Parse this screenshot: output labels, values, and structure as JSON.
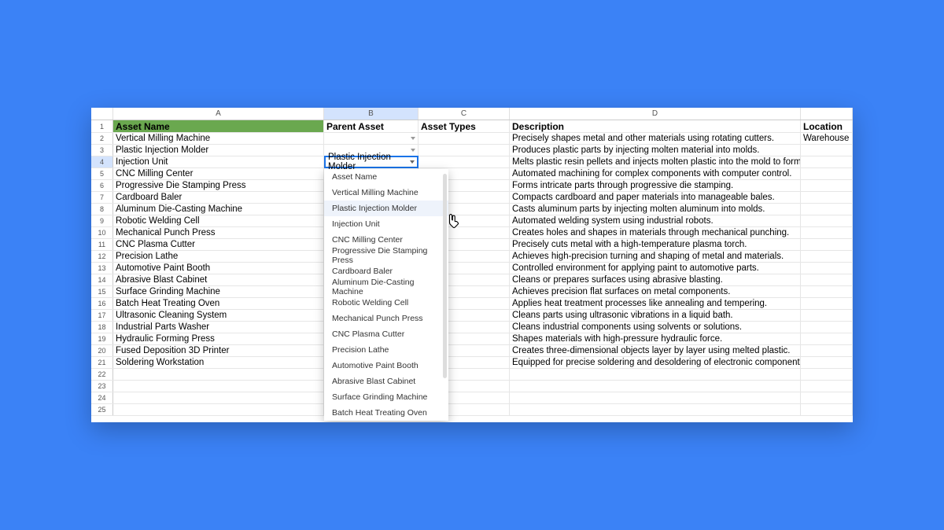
{
  "columns": [
    "A",
    "B",
    "C",
    "D"
  ],
  "selected_column_index": 1,
  "headers": {
    "A": "Asset Name",
    "B": "Parent Asset",
    "C": "Asset Types",
    "D": "Description",
    "E": "Location"
  },
  "active_cell": "Plastic Injection Molder",
  "rows": [
    {
      "n": 2,
      "A": "Vertical Milling Machine",
      "B": "",
      "C": "",
      "D": "Precisely shapes metal and other materials using rotating cutters.",
      "E": "Warehouse",
      "dd": true
    },
    {
      "n": 3,
      "A": "Plastic Injection Molder",
      "B": "",
      "C": "",
      "D": "Produces plastic parts by injecting molten material into molds.",
      "E": "",
      "dd": true
    },
    {
      "n": 4,
      "A": "Injection Unit",
      "B": "",
      "C": "",
      "D": "Melts plastic resin pellets and injects molten plastic into the mold to form parts",
      "E": "",
      "dd": false,
      "selected": true
    },
    {
      "n": 5,
      "A": "CNC Milling Center",
      "B": "",
      "C": "",
      "D": "Automated machining for complex components with computer control.",
      "E": "",
      "dd": false
    },
    {
      "n": 6,
      "A": "Progressive Die Stamping Press",
      "B": "",
      "C": "",
      "D": "Forms intricate parts through progressive die stamping.",
      "E": "",
      "dd": false
    },
    {
      "n": 7,
      "A": "Cardboard Baler",
      "B": "",
      "C": "",
      "D": "Compacts cardboard and paper materials into manageable bales.",
      "E": "",
      "dd": false
    },
    {
      "n": 8,
      "A": "Aluminum Die-Casting Machine",
      "B": "",
      "C": "",
      "D": "Casts aluminum parts by injecting molten aluminum into molds.",
      "E": "",
      "dd": false
    },
    {
      "n": 9,
      "A": "Robotic Welding Cell",
      "B": "",
      "C": "",
      "D": "Automated welding system using industrial robots.",
      "E": "",
      "dd": false
    },
    {
      "n": 10,
      "A": "Mechanical Punch Press",
      "B": "",
      "C": "",
      "D": "Creates holes and shapes in materials through mechanical punching.",
      "E": "",
      "dd": false
    },
    {
      "n": 11,
      "A": "CNC Plasma Cutter",
      "B": "",
      "C": "",
      "D": "Precisely cuts metal with a high-temperature plasma torch.",
      "E": "",
      "dd": false
    },
    {
      "n": 12,
      "A": "Precision Lathe",
      "B": "",
      "C": "",
      "D": "Achieves high-precision turning and shaping of metal and materials.",
      "E": "",
      "dd": false
    },
    {
      "n": 13,
      "A": "Automotive Paint Booth",
      "B": "",
      "C": "",
      "D": "Controlled environment for applying paint to automotive parts.",
      "E": "",
      "dd": false
    },
    {
      "n": 14,
      "A": "Abrasive Blast Cabinet",
      "B": "",
      "C": "",
      "D": "Cleans or prepares surfaces using abrasive blasting.",
      "E": "",
      "dd": false
    },
    {
      "n": 15,
      "A": "Surface Grinding Machine",
      "B": "",
      "C": "",
      "D": "Achieves precision flat surfaces on metal components.",
      "E": "",
      "dd": false
    },
    {
      "n": 16,
      "A": "Batch Heat Treating Oven",
      "B": "",
      "C": "",
      "D": "Applies heat treatment processes like annealing and tempering.",
      "E": "",
      "dd": false
    },
    {
      "n": 17,
      "A": "Ultrasonic Cleaning System",
      "B": "",
      "C": "",
      "D": "Cleans parts using ultrasonic vibrations in a liquid bath.",
      "E": "",
      "dd": false
    },
    {
      "n": 18,
      "A": "Industrial Parts Washer",
      "B": "",
      "C": "",
      "D": "Cleans industrial components using solvents or solutions.",
      "E": "",
      "dd": false
    },
    {
      "n": 19,
      "A": "Hydraulic Forming Press",
      "B": "",
      "C": "",
      "D": "Shapes materials with high-pressure hydraulic force.",
      "E": "",
      "dd": false
    },
    {
      "n": 20,
      "A": "Fused Deposition 3D Printer",
      "B": "",
      "C": "",
      "D": "Creates three-dimensional objects layer by layer using melted plastic.",
      "E": "",
      "dd": false
    },
    {
      "n": 21,
      "A": "Soldering Workstation",
      "B": "",
      "C": "",
      "D": "Equipped for precise soldering and desoldering of electronic components.",
      "E": "",
      "dd": false
    },
    {
      "n": 22,
      "A": "",
      "B": "",
      "C": "",
      "D": "",
      "E": ""
    },
    {
      "n": 23,
      "A": "",
      "B": "",
      "C": "",
      "D": "",
      "E": ""
    },
    {
      "n": 24,
      "A": "",
      "B": "",
      "C": "",
      "D": "",
      "E": ""
    },
    {
      "n": 25,
      "A": "",
      "B": "",
      "C": "",
      "D": "",
      "E": ""
    }
  ],
  "dropdown": {
    "options": [
      "Asset Name",
      "Vertical Milling Machine",
      "Plastic Injection Molder",
      "Injection Unit",
      "CNC Milling Center",
      "Progressive Die Stamping Press",
      "Cardboard Baler",
      "Aluminum Die-Casting Machine",
      "Robotic Welding Cell",
      "Mechanical Punch Press",
      "CNC Plasma Cutter",
      "Precision Lathe",
      "Automotive Paint Booth",
      "Abrasive Blast Cabinet",
      "Surface Grinding Machine",
      "Batch Heat Treating Oven"
    ],
    "hover_index": 2
  }
}
